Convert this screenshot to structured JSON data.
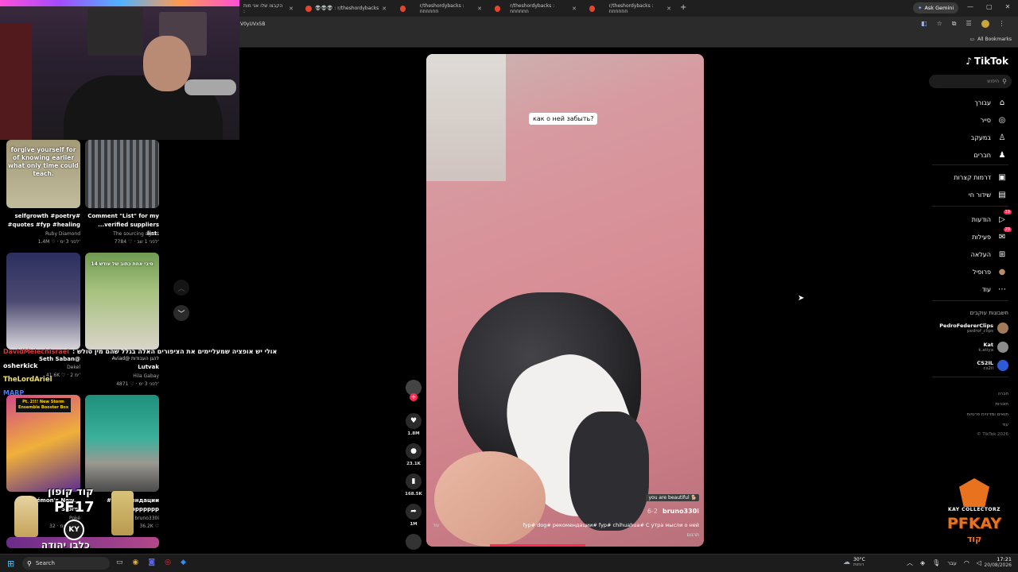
{
  "browser": {
    "tabs": [
      {
        "label": "הקבצו שלו אני מות :"
      },
      {
        "label": "👽👽👽 : r/theshordybacks"
      },
      {
        "label": "r/theshordybacks : חחחחחח"
      },
      {
        "label": "r/theshordybacks : חחחחחח"
      },
      {
        "label": "r/theshordybacks : חחחחחח"
      }
    ],
    "new_tab": "+",
    "ask_gemini": "Ask Gemini",
    "url_fragment": "V0yUVx5B",
    "all_bookmarks": "All Bookmarks"
  },
  "feed": {
    "row1": [
      {
        "overlay": "forgive yourself for of knowing earlier what only time could teach.",
        "caption": "selfgrowth #poetry# #quotes #fyp #healing",
        "author": "Ruby Diamond",
        "stats": "1.4M ♡ · לפני 3 ימ'"
      },
      {
        "overlay": "",
        "caption": "Comment \"List\" for my ...verified suppliers list.",
        "author": "The sourcing agent",
        "stats": "7784 ♡ · לפני 1 שב'"
      }
    ],
    "row2": [
      {
        "overlay": "",
        "caption": "Seth Saban@",
        "author": "Dekel",
        "stats": "41.6K ♡ · 2 ימ'"
      },
      {
        "overlay": "סיבי אחת כתוב של עודש 14",
        "caption": "Aviad@ להגן העבודות",
        "caption2": "Lutvak",
        "author": "Hila Gabay",
        "stats": "4871 ♡ · לפני 3 ימ'"
      }
    ],
    "row3": [
      {
        "overlay": "Pt. 2!!! New Storm Ensemble Booster Box",
        "caption": "Pokémon's New...",
        "caption2": "Storm",
        "author": "Poké",
        "stats": "32 · לפני 2 ימ'"
      },
      {
        "overlay": "",
        "caption": "#рекомендации",
        "caption2": "#fyppppppp",
        "author": "bruno330i",
        "stats": "36.2K ♡"
      }
    ]
  },
  "chat": {
    "messages": [
      {
        "user": "DavidMelechIsrael",
        "color": "#d43a3a",
        "text": "אולי יש אופציה שמעליימים את הציפורים האלה בגלל שהם מין טולש :"
      },
      {
        "user": "osherkick",
        "color": "#ffffff",
        "text": ""
      },
      {
        "user": "TheLordAriel",
        "color": "#f0e060",
        "text": ""
      },
      {
        "user": "MARP",
        "color": "#4a7cff",
        "text": ""
      }
    ]
  },
  "promo": {
    "code_label": "קוד קופון",
    "code": "PF17",
    "brand_badge": "KY",
    "footer": "כלבו יהודה"
  },
  "video": {
    "overlay_text": "как о ней забыть?",
    "tag": "you are beautiful 🐕",
    "author": "bruno330i",
    "date": "6-2",
    "description": "fyp# dog# рекомендации# fyp# chihuahua# С утра мысли о ней",
    "more": "עוד",
    "translate": "תרגום"
  },
  "actions": {
    "likes": "1.8M",
    "comments": "23.1K",
    "saves": "168.5K",
    "shares": "1M"
  },
  "tiktok": {
    "logo": "TikTok",
    "search_placeholder": "חיפוש",
    "nav": [
      {
        "label": "עבורך",
        "icon": "home-icon",
        "glyph": "⌂"
      },
      {
        "label": "סייר",
        "icon": "compass-icon",
        "glyph": "◎"
      },
      {
        "label": "במעקב",
        "icon": "user-plus-icon",
        "glyph": "♙"
      },
      {
        "label": "חברים",
        "icon": "friends-icon",
        "glyph": "♟"
      },
      {
        "label": "דרמות קצרות",
        "icon": "drama-icon",
        "glyph": "▣"
      },
      {
        "label": "שידור חי",
        "icon": "live-icon",
        "glyph": "▤"
      },
      {
        "label": "הודעות",
        "icon": "inbox-icon",
        "glyph": "▷",
        "badge": "19"
      },
      {
        "label": "פעילות",
        "icon": "activity-icon",
        "glyph": "✉",
        "badge": "29"
      },
      {
        "label": "העלאה",
        "icon": "upload-icon",
        "glyph": "⊞"
      },
      {
        "label": "פרופיל",
        "icon": "profile-avatar-icon",
        "glyph": "●"
      },
      {
        "label": "עוד",
        "icon": "more-icon",
        "glyph": "⋯"
      }
    ],
    "following_header": "חשבונות עוקבים",
    "following": [
      {
        "name": "PedroFedererClips",
        "handle": "pedrof_clips"
      },
      {
        "name": "Kat",
        "handle": "k.atiya"
      },
      {
        "name": "CS2IL",
        "handle": "cs2il"
      }
    ],
    "footer_links": [
      "חברה",
      "תוכניות",
      "תנאים ומדיניות פרטיות",
      "עוד"
    ],
    "copyright": "© TikTok 2026"
  },
  "brand_overlay": {
    "top": "KAY COLLECTORZ",
    "main": "PFKAY",
    "sub": "קוד"
  },
  "taskbar": {
    "search": "Search",
    "weather": "30°C",
    "weather_sub": "רוחות",
    "lang": "עבר",
    "time": "17:21",
    "date": "20/08/2026"
  },
  "colors": {
    "tiktok_red": "#fe2c55",
    "tiktok_cyan": "#25f4ee",
    "pfkay_orange": "#e8721e"
  }
}
